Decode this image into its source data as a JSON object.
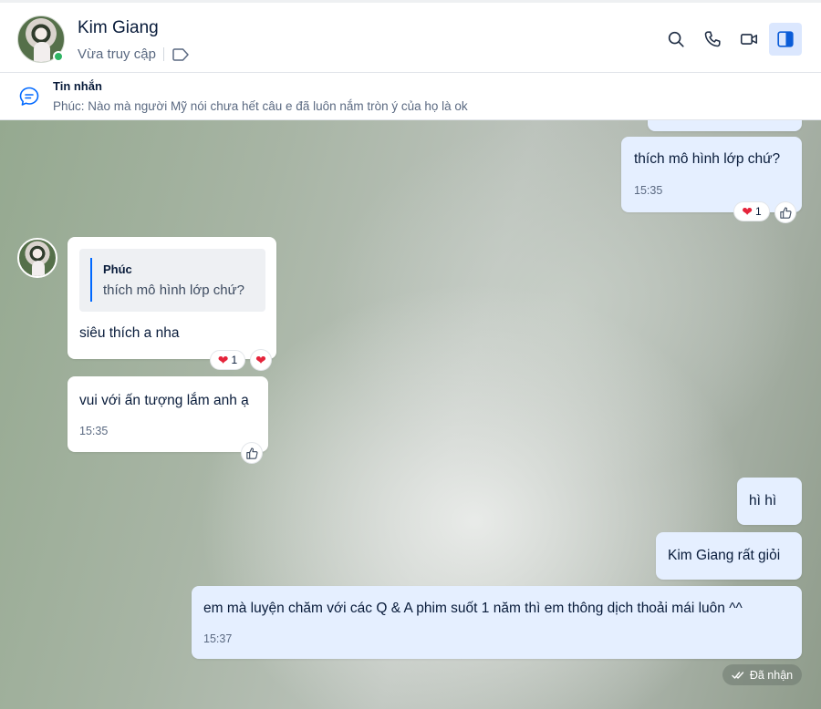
{
  "header": {
    "contact_name": "Kim Giang",
    "status": "Vừa truy cập",
    "icons": [
      "search-icon",
      "phone-icon",
      "video-call-icon",
      "side-panel-icon"
    ]
  },
  "pinned": {
    "title": "Tin nhắn",
    "preview": "Phúc: Nào mà người Mỹ nói chưa hết câu e đã luôn nắm tròn ý của họ là ok"
  },
  "messages": [
    {
      "from": "me",
      "text": "thích mô hình lớp chứ?",
      "time": "15:35",
      "reaction_count": "1"
    },
    {
      "from": "them",
      "quote_author": "Phúc",
      "quote_text": "thích mô hình lớp chứ?",
      "text": "siêu thích a nha",
      "reaction_count": "1"
    },
    {
      "from": "them",
      "text": "vui với ấn tượng lắm anh ạ",
      "time": "15:35"
    },
    {
      "from": "me",
      "text": "hì hì"
    },
    {
      "from": "me",
      "text": "Kim Giang rất giỏi"
    },
    {
      "from": "me",
      "text": "em mà luyện chăm với các Q & A phim suốt 1 năm thì em thông dịch thoải mái luôn ^^",
      "time": "15:37"
    }
  ],
  "delivery_status": "Đã nhận",
  "colors": {
    "my_bubble": "#e5efff",
    "their_bubble": "#ffffff",
    "accent": "#0068ff",
    "online": "#2fb464",
    "heart": "#e5243b"
  }
}
